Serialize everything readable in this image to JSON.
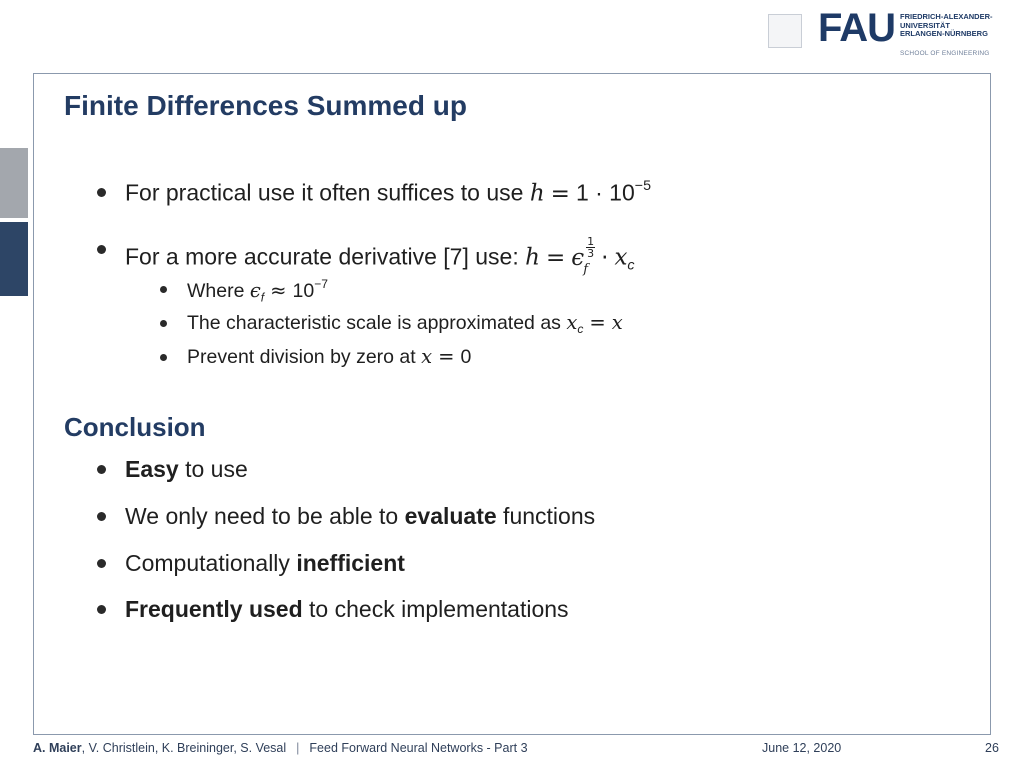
{
  "header": {
    "logo_word": "FAU",
    "university_lines": [
      "FRIEDRICH-ALEXANDER-",
      "UNIVERSITÄT",
      "ERLANGEN-NÜRNBERG"
    ],
    "school": "SCHOOL OF ENGINEERING"
  },
  "slide": {
    "title": "Finite Differences Summed up",
    "bullet1": {
      "text": "For practical use it often suffices to use ",
      "var": "h",
      "eq": "=",
      "value": "1 · 10",
      "exp": "−5"
    },
    "bullet2": {
      "text": "For a more accurate derivative [7] use: ",
      "var": "h",
      "eq": "=",
      "eps": "ϵ",
      "eps_sub": "f",
      "frac_num": "1",
      "frac_den": "3",
      "dot": "·",
      "xc": "x",
      "xc_sub": "c"
    },
    "sub1": {
      "text": "Where ",
      "eps": "ϵ",
      "eps_sub": "f",
      "approx": "≈",
      "value": "10",
      "exp": "−7"
    },
    "sub2": {
      "text": "The characteristic scale is approximated as ",
      "xc": "x",
      "xc_sub": "c",
      "eq": "=",
      "x": "x"
    },
    "sub3": {
      "text": "Prevent division by zero at ",
      "x": "x",
      "eq": "=",
      "value": "0"
    },
    "conclusion_title": "Conclusion",
    "conclusion": [
      {
        "bold": "Easy",
        "rest": " to use"
      },
      {
        "pre": "We only need to be able to ",
        "bold": "evaluate",
        "rest": " functions"
      },
      {
        "pre": "Computationally ",
        "bold": "inefficient"
      },
      {
        "bold": "Frequently used",
        "rest": " to check implementations"
      }
    ]
  },
  "footer": {
    "lead_author": "A. Maier",
    "other_authors": ", V. Christlein, K. Breininger, S. Vesal",
    "separator": "|",
    "lecture": "Feed Forward Neural Networks - Part 3",
    "date": "June 12, 2020",
    "page": "26"
  }
}
